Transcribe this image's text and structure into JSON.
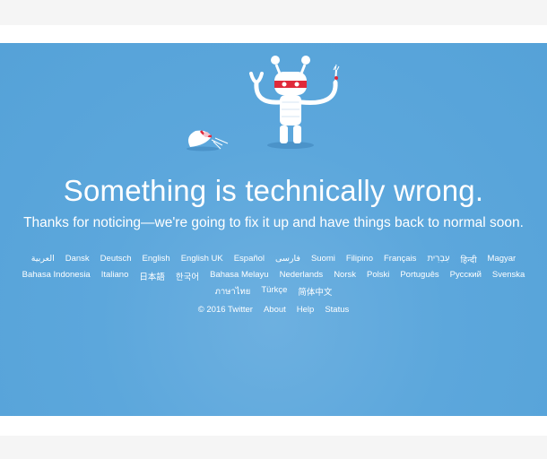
{
  "error": {
    "headline": "Something is technically wrong.",
    "subline": "Thanks for noticing—we're going to fix it up and have things back to normal soon."
  },
  "languages": {
    "row1": [
      "العربية",
      "Dansk",
      "Deutsch",
      "English",
      "English UK",
      "Español",
      "فارسی",
      "Suomi",
      "Filipino",
      "Français",
      "עִבְרִית",
      "हिन्दी",
      "Magyar"
    ],
    "row2": [
      "Bahasa Indonesia",
      "Italiano",
      "日本語",
      "한국어",
      "Bahasa Melayu",
      "Nederlands",
      "Norsk",
      "Polski",
      "Português",
      "Русский",
      "Svenska"
    ],
    "row3": [
      "ภาษาไทย",
      "Türkçe",
      "简体中文"
    ]
  },
  "footer": {
    "copyright": "© 2016 Twitter",
    "about": "About",
    "help": "Help",
    "status": "Status"
  },
  "colors": {
    "panel_bg": "#5ca7dc",
    "text": "#ffffff",
    "robot_visor": "#e0293a"
  },
  "icons": {
    "illustration": "broken-robot-illustration"
  }
}
